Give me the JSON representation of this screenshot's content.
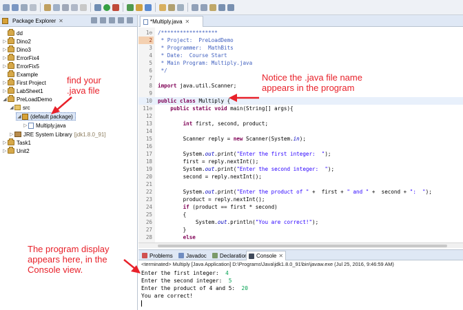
{
  "package_explorer": {
    "title": "Package Explorer",
    "close": "✕",
    "items": [
      {
        "label": "dd",
        "type": "project"
      },
      {
        "label": "Dino2",
        "type": "project"
      },
      {
        "label": "Dino3",
        "type": "project"
      },
      {
        "label": "ErrorFix4",
        "type": "project"
      },
      {
        "label": "ErrorFix5",
        "type": "project"
      },
      {
        "label": "Example",
        "type": "project"
      },
      {
        "label": "First Project",
        "type": "project"
      },
      {
        "label": "LabSheet1",
        "type": "project"
      },
      {
        "label": "PreLoadDemo",
        "type": "project"
      },
      {
        "label": "src",
        "type": "src"
      },
      {
        "label": "(default package)",
        "type": "package"
      },
      {
        "label": "Multiply.java",
        "type": "file"
      },
      {
        "label": "JRE System Library",
        "suffix": "[jdk1.8.0_91]",
        "type": "library"
      },
      {
        "label": "Task1",
        "type": "project"
      },
      {
        "label": "Unit2",
        "type": "project"
      }
    ]
  },
  "editor": {
    "tab_label": "*Multiply.java",
    "tab_close": "✕"
  },
  "console_tabs": [
    {
      "label": "Problems"
    },
    {
      "label": "Javadoc"
    },
    {
      "label": "Declaration"
    },
    {
      "label": "Console"
    }
  ],
  "console": {
    "status": "<terminated> Multiply [Java Application] D:\\Programs\\Java\\jdk1.8.0_91\\bin\\javaw.exe (Jul 25, 2016, 9:46:59 AM)",
    "lines": [
      {
        "text": "Enter the first integer:  ",
        "input": "4"
      },
      {
        "text": "Enter the second integer:  ",
        "input": "5"
      },
      {
        "text": "Enter the product of 4 and 5:  ",
        "input": "20"
      },
      {
        "text": "You are correct!",
        "input": ""
      }
    ]
  },
  "annotations": {
    "find_java_file": "find your\n.java file",
    "notice_name": "Notice the .java file name\nappears in the program",
    "console_note": "The program display\nappears here, in the\nConsole view."
  },
  "colors": {
    "annotation": "#e8212a",
    "keyword": "#7f0055",
    "comment": "#3f5fbf",
    "string": "#2a00ff",
    "field": "#0000c0",
    "console_input": "#00a050"
  }
}
